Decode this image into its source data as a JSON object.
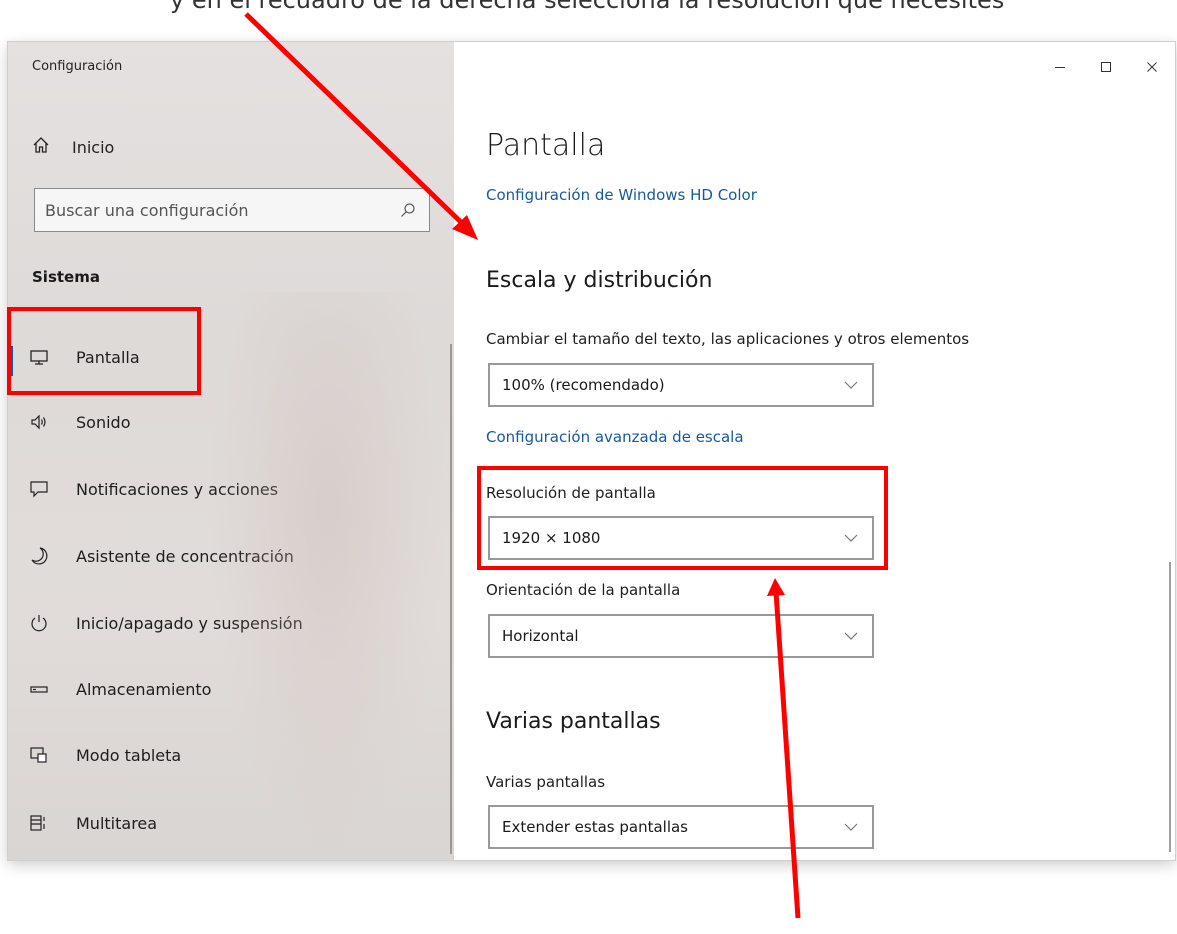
{
  "caption": "y en el recuadro de la derecha selecciona la resolución que necesites",
  "window": {
    "title": "Configuración",
    "controls": [
      "minimize-icon",
      "maximize-icon",
      "close-icon"
    ]
  },
  "sidebar": {
    "home_label": "Inicio",
    "search_placeholder": "Buscar una configuración",
    "section": "Sistema",
    "items": [
      {
        "label": "Pantalla",
        "icon": "monitor-icon",
        "active": true
      },
      {
        "label": "Sonido",
        "icon": "speaker-icon"
      },
      {
        "label": "Notificaciones y acciones",
        "icon": "notification-icon"
      },
      {
        "label": "Asistente de concentración",
        "icon": "moon-icon"
      },
      {
        "label": "Inicio/apagado y suspensión",
        "icon": "power-icon"
      },
      {
        "label": "Almacenamiento",
        "icon": "storage-icon"
      },
      {
        "label": "Modo tableta",
        "icon": "tablet-icon"
      },
      {
        "label": "Multitarea",
        "icon": "multitask-icon"
      }
    ]
  },
  "main": {
    "title": "Pantalla",
    "hd_color_link": "Configuración de Windows HD Color",
    "scale_heading": "Escala y distribución",
    "scale_label": "Cambiar el tamaño del texto, las aplicaciones y otros elementos",
    "scale_value": "100% (recomendado)",
    "advanced_scale_link": "Configuración avanzada de escala",
    "resolution_label": "Resolución de pantalla",
    "resolution_value": "1920 × 1080",
    "orientation_label": "Orientación de la pantalla",
    "orientation_value": "Horizontal",
    "multi_heading": "Varias pantallas",
    "multi_label": "Varias pantallas",
    "multi_value": "Extender estas pantallas"
  },
  "annotations": {
    "color": "#ff0000"
  }
}
